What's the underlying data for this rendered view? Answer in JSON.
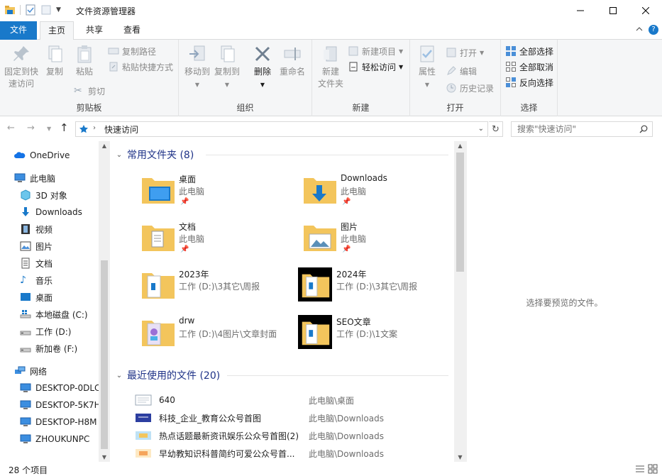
{
  "window": {
    "title": "文件资源管理器"
  },
  "tabs": {
    "file": "文件",
    "home": "主页",
    "share": "共享",
    "view": "查看",
    "help": "?"
  },
  "ribbon": {
    "clipboard": {
      "label": "剪贴板",
      "pin_line1": "固定到快",
      "pin_line2": "速访问",
      "copy": "复制",
      "paste": "粘贴",
      "copy_path": "复制路径",
      "paste_shortcut": "粘贴快捷方式",
      "cut": "剪切"
    },
    "organize": {
      "label": "组织",
      "move_to": "移动到",
      "copy_to": "复制到",
      "delete": "删除",
      "rename": "重命名"
    },
    "new": {
      "label": "新建",
      "new_folder_line1": "新建",
      "new_folder_line2": "文件夹",
      "new_item": "新建项目",
      "easy_access": "轻松访问"
    },
    "open": {
      "label": "打开",
      "properties": "属性",
      "open": "打开",
      "edit": "编辑",
      "history": "历史记录"
    },
    "select": {
      "label": "选择",
      "select_all": "全部选择",
      "select_none": "全部取消",
      "invert": "反向选择"
    }
  },
  "address": {
    "path": "快速访问",
    "search_placeholder": "搜索\"快速访问\""
  },
  "navpane": {
    "items": [
      {
        "label": "OneDrive"
      },
      {
        "label": "此电脑"
      },
      {
        "label": "3D 对象"
      },
      {
        "label": "Downloads"
      },
      {
        "label": "视频"
      },
      {
        "label": "图片"
      },
      {
        "label": "文档"
      },
      {
        "label": "音乐"
      },
      {
        "label": "桌面"
      },
      {
        "label": "本地磁盘 (C:)"
      },
      {
        "label": "工作 (D:)"
      },
      {
        "label": "新加卷 (F:)"
      },
      {
        "label": "网络"
      },
      {
        "label": "DESKTOP-0DLC"
      },
      {
        "label": "DESKTOP-5K7H"
      },
      {
        "label": "DESKTOP-H8M"
      },
      {
        "label": "ZHOUKUNPC"
      }
    ]
  },
  "frequent": {
    "header": "常用文件夹 (8)",
    "folders": [
      {
        "name": "桌面",
        "location": "此电脑"
      },
      {
        "name": "Downloads",
        "location": "此电脑"
      },
      {
        "name": "文档",
        "location": "此电脑"
      },
      {
        "name": "图片",
        "location": "此电脑"
      },
      {
        "name": "2023年",
        "location": "工作 (D:)\\3其它\\周报"
      },
      {
        "name": "2024年",
        "location": "工作 (D:)\\3其它\\周报"
      },
      {
        "name": "drw",
        "location": "工作 (D:)\\4图片\\文章封面"
      },
      {
        "name": "SEO文章",
        "location": "工作 (D:)\\1文案"
      }
    ]
  },
  "recent": {
    "header": "最近使用的文件 (20)",
    "files": [
      {
        "name": "640",
        "location": "此电脑\\桌面"
      },
      {
        "name": "科技_企业_教育公众号首图",
        "location": "此电脑\\Downloads"
      },
      {
        "name": "热点话题最新资讯娱乐公众号首图(2)",
        "location": "此电脑\\Downloads"
      },
      {
        "name": "早幼教知识科普简约可爱公众号首...",
        "location": "此电脑\\Downloads"
      }
    ]
  },
  "preview": {
    "text": "选择要预览的文件。"
  },
  "status": {
    "count": "28 个项目"
  },
  "colors": {
    "accent": "#1979ca",
    "folder": "#f3c55c",
    "section": "#1e3287"
  }
}
